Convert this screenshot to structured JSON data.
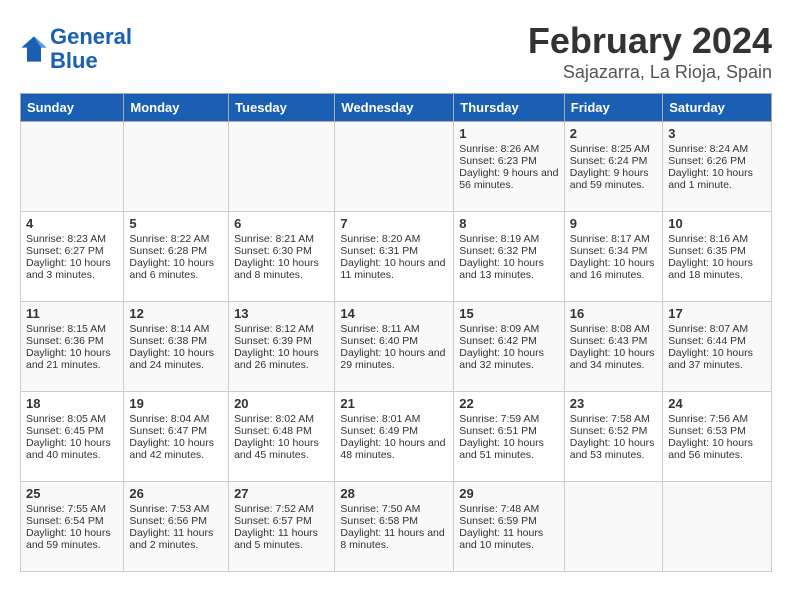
{
  "header": {
    "logo_line1": "General",
    "logo_line2": "Blue",
    "title": "February 2024",
    "subtitle": "Sajazarra, La Rioja, Spain"
  },
  "weekdays": [
    "Sunday",
    "Monday",
    "Tuesday",
    "Wednesday",
    "Thursday",
    "Friday",
    "Saturday"
  ],
  "weeks": [
    [
      {
        "day": "",
        "sunrise": "",
        "sunset": "",
        "daylight": ""
      },
      {
        "day": "",
        "sunrise": "",
        "sunset": "",
        "daylight": ""
      },
      {
        "day": "",
        "sunrise": "",
        "sunset": "",
        "daylight": ""
      },
      {
        "day": "",
        "sunrise": "",
        "sunset": "",
        "daylight": ""
      },
      {
        "day": "1",
        "sunrise": "Sunrise: 8:26 AM",
        "sunset": "Sunset: 6:23 PM",
        "daylight": "Daylight: 9 hours and 56 minutes."
      },
      {
        "day": "2",
        "sunrise": "Sunrise: 8:25 AM",
        "sunset": "Sunset: 6:24 PM",
        "daylight": "Daylight: 9 hours and 59 minutes."
      },
      {
        "day": "3",
        "sunrise": "Sunrise: 8:24 AM",
        "sunset": "Sunset: 6:26 PM",
        "daylight": "Daylight: 10 hours and 1 minute."
      }
    ],
    [
      {
        "day": "4",
        "sunrise": "Sunrise: 8:23 AM",
        "sunset": "Sunset: 6:27 PM",
        "daylight": "Daylight: 10 hours and 3 minutes."
      },
      {
        "day": "5",
        "sunrise": "Sunrise: 8:22 AM",
        "sunset": "Sunset: 6:28 PM",
        "daylight": "Daylight: 10 hours and 6 minutes."
      },
      {
        "day": "6",
        "sunrise": "Sunrise: 8:21 AM",
        "sunset": "Sunset: 6:30 PM",
        "daylight": "Daylight: 10 hours and 8 minutes."
      },
      {
        "day": "7",
        "sunrise": "Sunrise: 8:20 AM",
        "sunset": "Sunset: 6:31 PM",
        "daylight": "Daylight: 10 hours and 11 minutes."
      },
      {
        "day": "8",
        "sunrise": "Sunrise: 8:19 AM",
        "sunset": "Sunset: 6:32 PM",
        "daylight": "Daylight: 10 hours and 13 minutes."
      },
      {
        "day": "9",
        "sunrise": "Sunrise: 8:17 AM",
        "sunset": "Sunset: 6:34 PM",
        "daylight": "Daylight: 10 hours and 16 minutes."
      },
      {
        "day": "10",
        "sunrise": "Sunrise: 8:16 AM",
        "sunset": "Sunset: 6:35 PM",
        "daylight": "Daylight: 10 hours and 18 minutes."
      }
    ],
    [
      {
        "day": "11",
        "sunrise": "Sunrise: 8:15 AM",
        "sunset": "Sunset: 6:36 PM",
        "daylight": "Daylight: 10 hours and 21 minutes."
      },
      {
        "day": "12",
        "sunrise": "Sunrise: 8:14 AM",
        "sunset": "Sunset: 6:38 PM",
        "daylight": "Daylight: 10 hours and 24 minutes."
      },
      {
        "day": "13",
        "sunrise": "Sunrise: 8:12 AM",
        "sunset": "Sunset: 6:39 PM",
        "daylight": "Daylight: 10 hours and 26 minutes."
      },
      {
        "day": "14",
        "sunrise": "Sunrise: 8:11 AM",
        "sunset": "Sunset: 6:40 PM",
        "daylight": "Daylight: 10 hours and 29 minutes."
      },
      {
        "day": "15",
        "sunrise": "Sunrise: 8:09 AM",
        "sunset": "Sunset: 6:42 PM",
        "daylight": "Daylight: 10 hours and 32 minutes."
      },
      {
        "day": "16",
        "sunrise": "Sunrise: 8:08 AM",
        "sunset": "Sunset: 6:43 PM",
        "daylight": "Daylight: 10 hours and 34 minutes."
      },
      {
        "day": "17",
        "sunrise": "Sunrise: 8:07 AM",
        "sunset": "Sunset: 6:44 PM",
        "daylight": "Daylight: 10 hours and 37 minutes."
      }
    ],
    [
      {
        "day": "18",
        "sunrise": "Sunrise: 8:05 AM",
        "sunset": "Sunset: 6:45 PM",
        "daylight": "Daylight: 10 hours and 40 minutes."
      },
      {
        "day": "19",
        "sunrise": "Sunrise: 8:04 AM",
        "sunset": "Sunset: 6:47 PM",
        "daylight": "Daylight: 10 hours and 42 minutes."
      },
      {
        "day": "20",
        "sunrise": "Sunrise: 8:02 AM",
        "sunset": "Sunset: 6:48 PM",
        "daylight": "Daylight: 10 hours and 45 minutes."
      },
      {
        "day": "21",
        "sunrise": "Sunrise: 8:01 AM",
        "sunset": "Sunset: 6:49 PM",
        "daylight": "Daylight: 10 hours and 48 minutes."
      },
      {
        "day": "22",
        "sunrise": "Sunrise: 7:59 AM",
        "sunset": "Sunset: 6:51 PM",
        "daylight": "Daylight: 10 hours and 51 minutes."
      },
      {
        "day": "23",
        "sunrise": "Sunrise: 7:58 AM",
        "sunset": "Sunset: 6:52 PM",
        "daylight": "Daylight: 10 hours and 53 minutes."
      },
      {
        "day": "24",
        "sunrise": "Sunrise: 7:56 AM",
        "sunset": "Sunset: 6:53 PM",
        "daylight": "Daylight: 10 hours and 56 minutes."
      }
    ],
    [
      {
        "day": "25",
        "sunrise": "Sunrise: 7:55 AM",
        "sunset": "Sunset: 6:54 PM",
        "daylight": "Daylight: 10 hours and 59 minutes."
      },
      {
        "day": "26",
        "sunrise": "Sunrise: 7:53 AM",
        "sunset": "Sunset: 6:56 PM",
        "daylight": "Daylight: 11 hours and 2 minutes."
      },
      {
        "day": "27",
        "sunrise": "Sunrise: 7:52 AM",
        "sunset": "Sunset: 6:57 PM",
        "daylight": "Daylight: 11 hours and 5 minutes."
      },
      {
        "day": "28",
        "sunrise": "Sunrise: 7:50 AM",
        "sunset": "Sunset: 6:58 PM",
        "daylight": "Daylight: 11 hours and 8 minutes."
      },
      {
        "day": "29",
        "sunrise": "Sunrise: 7:48 AM",
        "sunset": "Sunset: 6:59 PM",
        "daylight": "Daylight: 11 hours and 10 minutes."
      },
      {
        "day": "",
        "sunrise": "",
        "sunset": "",
        "daylight": ""
      },
      {
        "day": "",
        "sunrise": "",
        "sunset": "",
        "daylight": ""
      }
    ]
  ]
}
